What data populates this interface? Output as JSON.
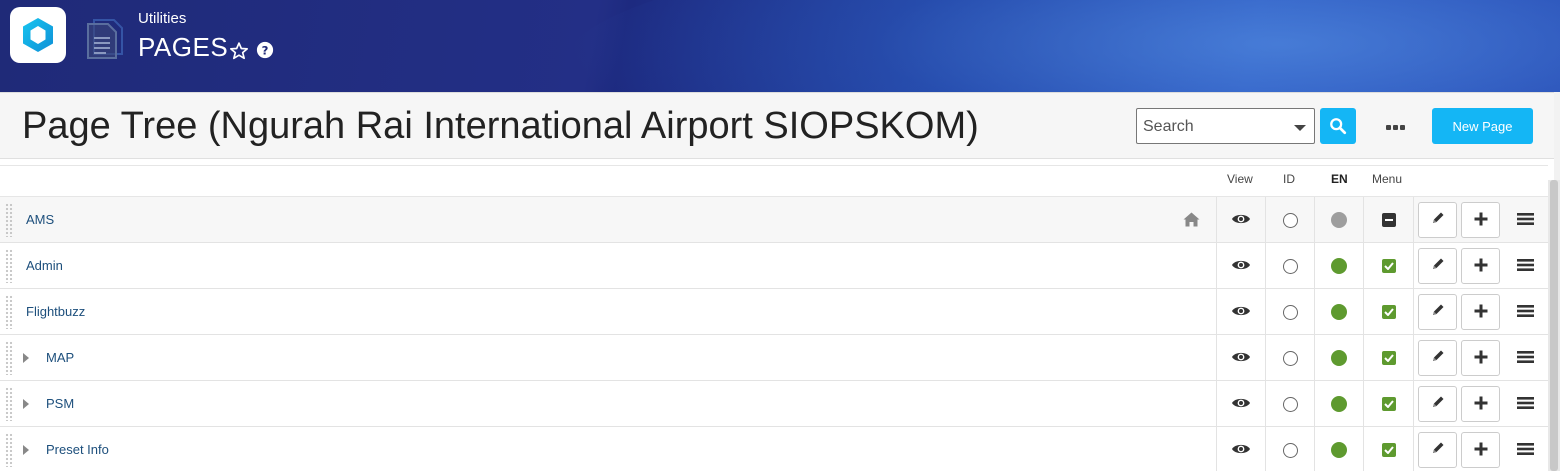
{
  "header": {
    "section": "Utilities",
    "title": "PAGES"
  },
  "page_tree": {
    "title": "Page Tree (Ngurah Rai International Airport SIOPSKOM)",
    "search": {
      "placeholder": "Search"
    },
    "new_page_label": "New Page"
  },
  "columns": {
    "view": "View",
    "id": "ID",
    "en": "EN",
    "menu": "Menu"
  },
  "colors": {
    "accent": "#14b6f5",
    "en_published": "#5e9a2f",
    "en_unpublished": "#9e9e9e",
    "menu_checked": "#5e9a2f",
    "link": "#1d4f7c"
  },
  "rows": [
    {
      "label": "AMS",
      "expandable": false,
      "home": true,
      "en_status": "unpublished",
      "menu": "indeterminate"
    },
    {
      "label": "Admin",
      "expandable": false,
      "home": false,
      "en_status": "published",
      "menu": "checked"
    },
    {
      "label": "Flightbuzz",
      "expandable": false,
      "home": false,
      "en_status": "published",
      "menu": "checked"
    },
    {
      "label": "MAP",
      "expandable": true,
      "home": false,
      "en_status": "published",
      "menu": "checked"
    },
    {
      "label": "PSM",
      "expandable": true,
      "home": false,
      "en_status": "published",
      "menu": "checked"
    },
    {
      "label": "Preset Info",
      "expandable": true,
      "home": false,
      "en_status": "published",
      "menu": "checked"
    }
  ]
}
